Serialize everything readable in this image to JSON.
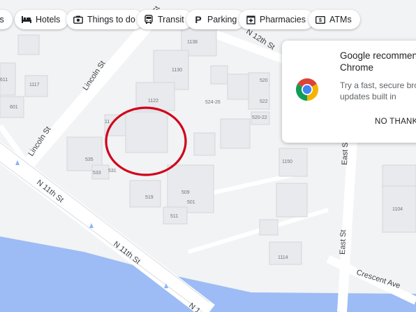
{
  "filter_chips": [
    {
      "label": "ts",
      "icon": "none"
    },
    {
      "label": "Hotels",
      "icon": "bed-icon"
    },
    {
      "label": "Things to do",
      "icon": "camera-icon"
    },
    {
      "label": "Transit",
      "icon": "bus-icon"
    },
    {
      "label": "Parking",
      "icon": "parking-icon"
    },
    {
      "label": "Pharmacies",
      "icon": "pharmacy-icon"
    },
    {
      "label": "ATMs",
      "icon": "atm-icon"
    }
  ],
  "promo": {
    "title": "Google recommen Chrome",
    "body": "Try a fast, secure brow updates built in",
    "dismiss_label": "NO THANKS",
    "icon": "chrome-logo-icon"
  },
  "streets": {
    "lincoln_st_upper": "Lincoln St",
    "lincoln_st_lower": "Lincoln St",
    "n_11th_st_left": "N 11th St",
    "n_11th_st_mid": "N 11th St",
    "n_11th_st_bottom": "N 1",
    "n_12th_st": "N 12th St",
    "east_st": "East St",
    "east_st_right": "East St",
    "crescent_ave": "Crescent Ave",
    "top_partial": "oln St"
  },
  "buildings": {
    "b1138": "1138",
    "b1130": "1130",
    "b1122": "1122",
    "b524_26": "524-26",
    "b520": "520",
    "b522": "522",
    "b520_22": "520-22",
    "b1117": "1117",
    "b611": "611",
    "b601": "601",
    "b535": "535",
    "b533": "533",
    "b531": "531",
    "b11x": "11",
    "b519": "519",
    "b509": "509",
    "b501": "501",
    "b511": "511",
    "b1150": "1150",
    "b1104": "1104",
    "b1114": "1114"
  },
  "colors": {
    "water": "#9dbcf5",
    "road": "#ffffff",
    "building": "#e8eaed",
    "highlight_circle": "#d0021b",
    "chip_bg": "#ffffff"
  }
}
